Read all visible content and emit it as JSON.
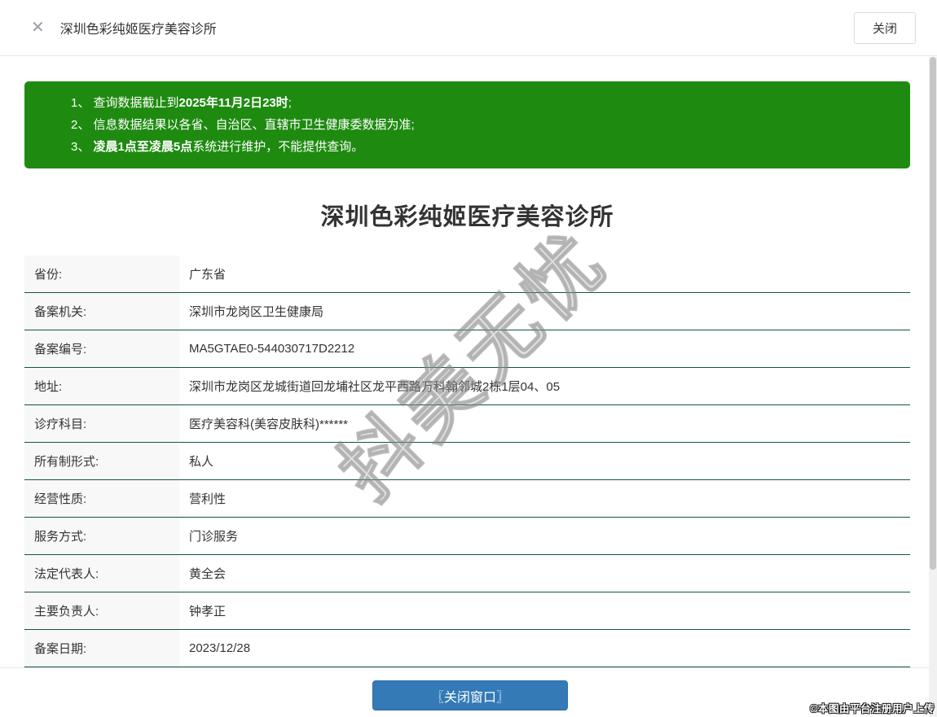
{
  "header": {
    "close_icon": "✕",
    "title": "深圳色彩纯姬医疗美容诊所",
    "close_button_label": "关闭"
  },
  "notice": {
    "items": [
      {
        "pre": "1、 查询数据截止到",
        "bold": "2025年11月2日23时",
        "post": ";"
      },
      {
        "pre": "2、 信息数据结果以各省、自治区、直辖市卫生健康委数据为准;",
        "bold": "",
        "post": ""
      },
      {
        "pre": "3、 ",
        "bold": "凌晨1点至凌晨5点",
        "post": "系统进行维护，不能提供查询。"
      }
    ]
  },
  "main": {
    "title": "深圳色彩纯姬医疗美容诊所",
    "fields": [
      {
        "label": "省份:",
        "value": "广东省"
      },
      {
        "label": "备案机关:",
        "value": "深圳市龙岗区卫生健康局"
      },
      {
        "label": "备案编号:",
        "value": "MA5GTAE0-544030717D2212"
      },
      {
        "label": "地址:",
        "value": "深圳市龙岗区龙城街道回龙埔社区龙平西路万科翰邻城2栋1层04、05"
      },
      {
        "label": "诊疗科目:",
        "value": "医疗美容科(美容皮肤科)******"
      },
      {
        "label": "所有制形式:",
        "value": "私人"
      },
      {
        "label": "经营性质:",
        "value": "营利性"
      },
      {
        "label": "服务方式:",
        "value": "门诊服务"
      },
      {
        "label": "法定代表人:",
        "value": "黄全会"
      },
      {
        "label": "主要负责人:",
        "value": "钟孝正"
      },
      {
        "label": "备案日期:",
        "value": "2023/12/28"
      }
    ]
  },
  "footer": {
    "close_window_label": "〖关闭窗口〗"
  },
  "watermark": {
    "text": "抖美无忧"
  },
  "copyright": "©本图由平台注册用户上传",
  "colors": {
    "notice_green": "#1e8b10",
    "row_divider_teal": "#135449",
    "button_blue": "#337ab7"
  }
}
